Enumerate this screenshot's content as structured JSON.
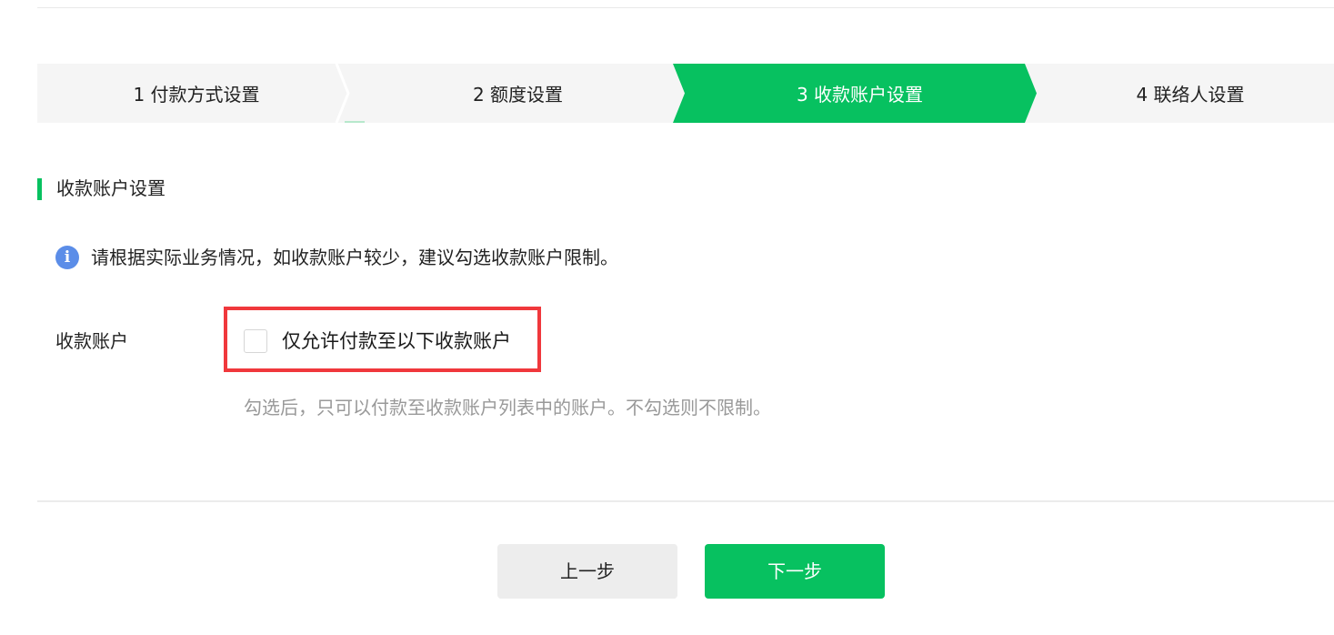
{
  "steps": [
    {
      "number": "1",
      "label": "付款方式设置",
      "active": false
    },
    {
      "number": "2",
      "label": "额度设置",
      "active": false
    },
    {
      "number": "3",
      "label": "收款账户设置",
      "active": true
    },
    {
      "number": "4",
      "label": "联络人设置",
      "active": false
    }
  ],
  "section": {
    "title": "收款账户设置"
  },
  "info_tip": {
    "icon": "info-icon",
    "icon_glyph": "i",
    "text": "请根据实际业务情况，如收款账户较少，建议勾选收款账户限制。"
  },
  "form": {
    "field_label": "收款账户",
    "checkbox_label": "仅允许付款至以下收款账户",
    "checked": false,
    "hint": "勾选后，只可以付款至收款账户列表中的账户。不勾选则不限制。"
  },
  "buttons": {
    "prev_label": "上一步",
    "next_label": "下一步"
  },
  "colors": {
    "accent": "#07c160",
    "highlight_border": "#f0383c",
    "info_icon": "#5b8de8"
  }
}
